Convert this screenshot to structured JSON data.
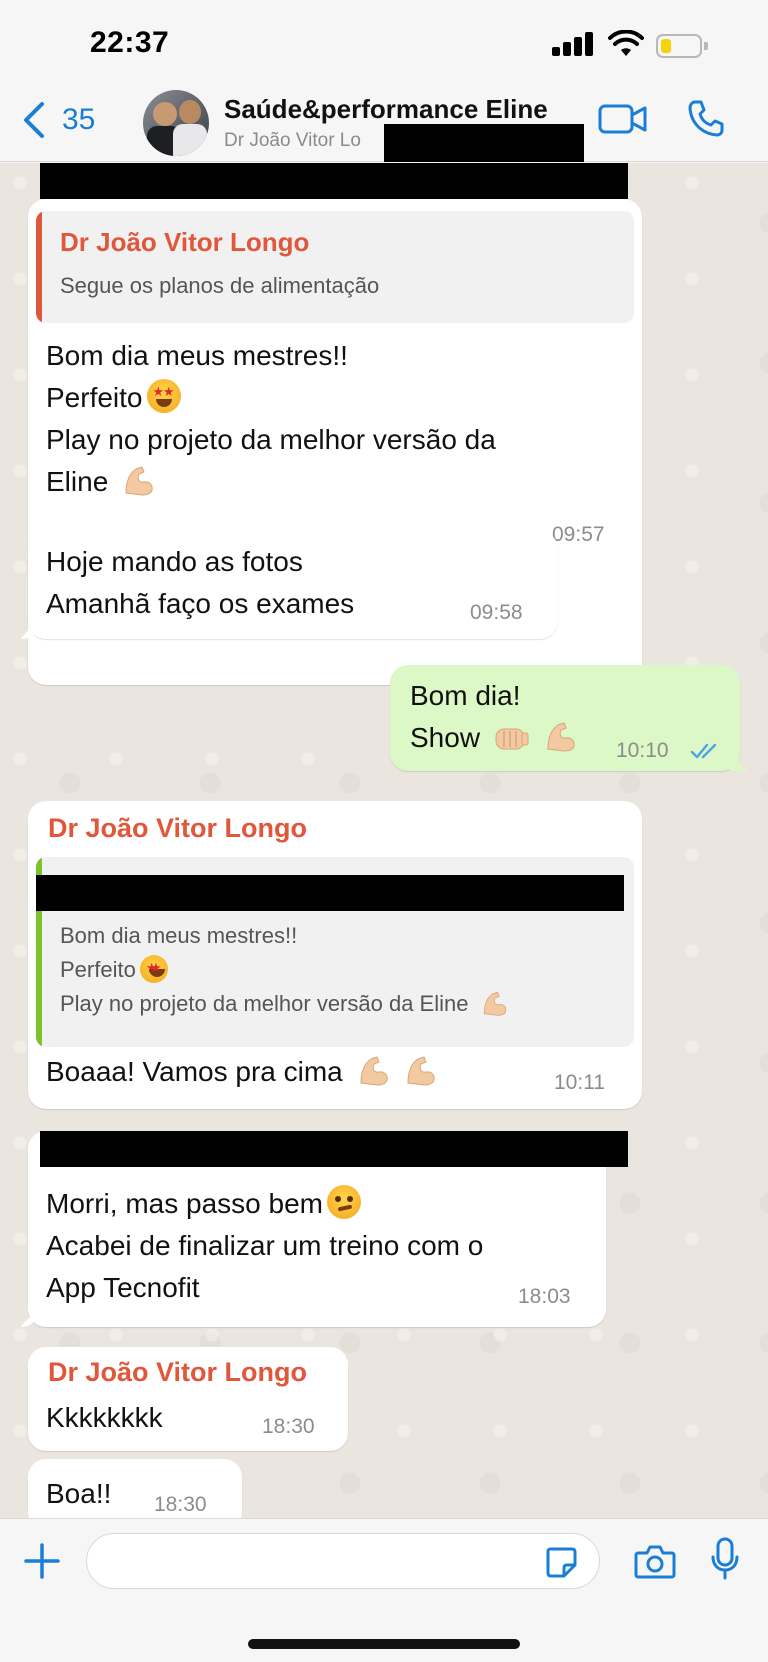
{
  "status_bar": {
    "time": "22:37"
  },
  "header": {
    "back_count": "35",
    "title": "Saúde&performance Eline",
    "subtitle": "Dr João Vitor Lo"
  },
  "messages": {
    "m1": {
      "quote_name": "Dr João Vitor Longo",
      "quote_text": "Segue os planos de alimentação",
      "lines": [
        "Bom dia meus mestres!!",
        "Perfeito",
        "Play no projeto da melhor versão da",
        "Eline"
      ],
      "time": "09:57"
    },
    "m2": {
      "lines": [
        "Hoje mando as fotos",
        "Amanhã faço os exames"
      ],
      "time": "09:58"
    },
    "m3": {
      "lines": [
        "Bom dia!",
        "Show"
      ],
      "time": "10:10",
      "status": "read"
    },
    "m4": {
      "sender": "Dr João Vitor Longo",
      "quote_lines": [
        "Bom dia meus mestres!!",
        "Perfeito",
        "Play no projeto da melhor versão da Eline"
      ],
      "text": "Boaaa! Vamos pra cima",
      "time": "10:11"
    },
    "m5": {
      "lines": [
        "Morri, mas passo bem",
        "Acabei de finalizar um treino com o",
        "App Tecnofit"
      ],
      "time": "18:03"
    },
    "m6": {
      "sender": "Dr João Vitor Longo",
      "text": "Kkkkkkkk",
      "time": "18:30"
    },
    "m7": {
      "text": "Boa!!",
      "time": "18:30"
    }
  },
  "input": {
    "placeholder": ""
  },
  "icons": {
    "back": "chevron-left-icon",
    "video": "video-camera-icon",
    "call": "phone-icon",
    "plus": "plus-icon",
    "sticker": "sticker-icon",
    "camera": "camera-icon",
    "mic": "microphone-icon"
  },
  "colors": {
    "accent": "#1a7ed6",
    "sender": "#e0573b",
    "outgoing_bubble": "#dcf8c6",
    "read_ticks": "#4fa3e3",
    "quote_bar_red": "#e0573b",
    "quote_bar_green": "#7cc22a"
  }
}
